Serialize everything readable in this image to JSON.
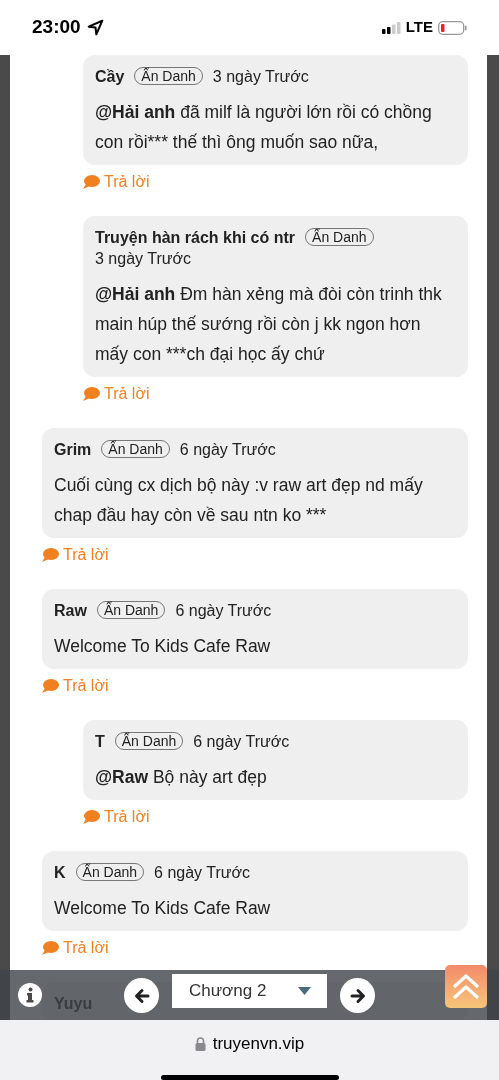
{
  "status_bar": {
    "time": "23:00",
    "network": "LTE"
  },
  "replies_continued": [
    {
      "name": "Cầy",
      "badge": "Ẩn Danh",
      "time": "3 ngày Trước",
      "text": "**@Hải anh** đã milf là người lớn rồi có chồng con rồi*** thế thì ông muốn sao nữa,",
      "reply": "Trả lời"
    },
    {
      "name": "Truyện hàn rách khi có ntr",
      "badge": "Ẩn Danh",
      "time": "3 ngày Trước",
      "text": "**@Hải anh** Đm hàn xẻng mà đòi còn trinh thk main húp thế sướng rồi còn j kk ngon hơn mấy con ***ch đại học ấy chứ",
      "reply": "Trả lời"
    }
  ],
  "comments": [
    {
      "name": "Grim",
      "badge": "Ẩn Danh",
      "time": "6 ngày Trước",
      "text": "Cuối cùng cx dịch bộ này :v raw art đẹp nd mấy chap đầu hay còn về sau ntn ko ***",
      "reply": "Trả lời"
    },
    {
      "name": "Raw",
      "badge": "Ẩn Danh",
      "time": "6 ngày Trước",
      "text": "Welcome To Kids Cafe Raw",
      "reply": "Trả lời",
      "children": [
        {
          "name": "T",
          "badge": "Ẩn Danh",
          "time": "6 ngày Trước",
          "text": "**@Raw** Bộ này art đẹp",
          "reply": "Trả lời"
        }
      ]
    },
    {
      "name": "K",
      "badge": "Ẩn Danh",
      "time": "6 ngày Trước",
      "text": "Welcome To Kids Cafe Raw",
      "reply": "Trả lời"
    },
    {
      "name": "Yuyu"
    }
  ],
  "chapter_nav": {
    "chapter": "Chương 2"
  },
  "browser_bar": {
    "url": "truyenvn.vip"
  }
}
